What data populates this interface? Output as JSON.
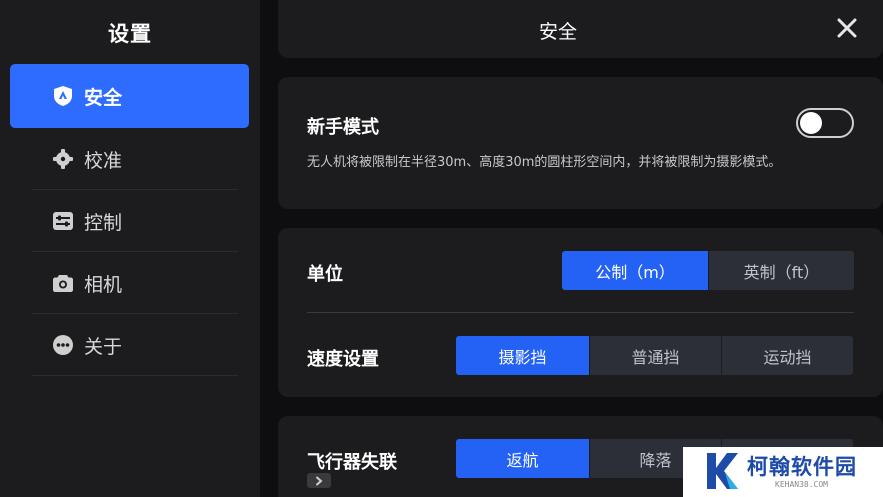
{
  "sidebar": {
    "title": "设置",
    "items": [
      {
        "label": "安全",
        "icon": "shield-icon",
        "active": true
      },
      {
        "label": "校准",
        "icon": "calibration-icon",
        "active": false
      },
      {
        "label": "控制",
        "icon": "sliders-icon",
        "active": false
      },
      {
        "label": "相机",
        "icon": "camera-icon",
        "active": false
      },
      {
        "label": "关于",
        "icon": "more-dots-icon",
        "active": false
      }
    ]
  },
  "header": {
    "title": "安全",
    "close_icon": "close-icon"
  },
  "beginner_mode": {
    "label": "新手模式",
    "description": "无人机将被限制在半径30m、高度30m的圆柱形空间内，并将被限制为摄影模式。",
    "enabled": false
  },
  "units": {
    "label": "单位",
    "options": [
      "公制（m）",
      "英制（ft）"
    ],
    "selected": "公制（m）"
  },
  "speed": {
    "label": "速度设置",
    "options": [
      "摄影挡",
      "普通挡",
      "运动挡"
    ],
    "selected": "摄影挡"
  },
  "lost_link": {
    "label": "飞行器失联",
    "options": [
      "返航",
      "降落",
      ""
    ],
    "selected": "返航"
  },
  "watermark": {
    "text": "柯翰软件园",
    "url": "KEHAN38.COM"
  },
  "colors": {
    "accent": "#2e6bff",
    "panel": "#1c1c1e",
    "background": "#0e0e10",
    "segment_off": "#2c2f38"
  }
}
